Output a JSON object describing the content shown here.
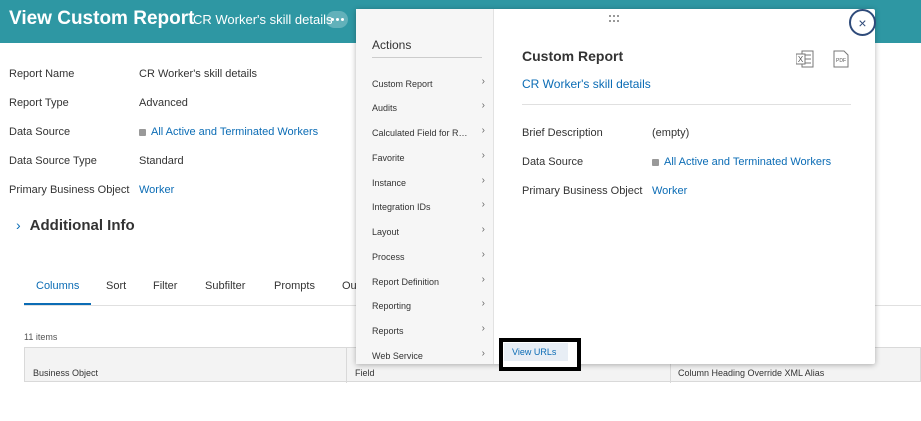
{
  "header": {
    "title": "View Custom Report",
    "subtitle": "CR Worker's skill details",
    "more_icon": "ellipsis-icon"
  },
  "details": [
    {
      "label": "Report Name",
      "value": "CR Worker's skill details",
      "link": false,
      "square": false
    },
    {
      "label": "Report Type",
      "value": "Advanced",
      "link": false,
      "square": false
    },
    {
      "label": "Data Source",
      "value": "All Active and Terminated Workers",
      "link": true,
      "square": true
    },
    {
      "label": "Data Source Type",
      "value": "Standard",
      "link": false,
      "square": false
    },
    {
      "label": "Primary Business Object",
      "value": "Worker",
      "link": true,
      "square": false
    }
  ],
  "additional_info": {
    "chevron": "›",
    "label": "Additional Info"
  },
  "tabs": [
    "Columns",
    "Sort",
    "Filter",
    "Subfilter",
    "Prompts",
    "Ou"
  ],
  "active_tab": "Columns",
  "table": {
    "count": "11 items",
    "headers": [
      "Business Object",
      "Field",
      "Column Heading Override XML Alias"
    ]
  },
  "popup": {
    "actions_title": "Actions",
    "menu": [
      "Custom Report",
      "Audits",
      "Calculated Field for Report",
      "Favorite",
      "Instance",
      "Integration IDs",
      "Layout",
      "Process",
      "Report Definition",
      "Reporting",
      "Reports",
      "Web Service"
    ],
    "menu_arrow": "›",
    "view_urls": "View URLs",
    "title": "Custom Report",
    "name": "CR Worker's skill details",
    "rows": [
      {
        "label": "Brief Description",
        "value": "(empty)",
        "link": false,
        "square": false
      },
      {
        "label": "Data Source",
        "value": "All Active and Terminated Workers",
        "link": true,
        "square": true
      },
      {
        "label": "Primary Business Object",
        "value": "Worker",
        "link": true,
        "square": false
      }
    ],
    "excel_label": "X",
    "pdf_label": "PDF",
    "close_symbol": "×"
  },
  "colors": {
    "header": "#2e97a3",
    "link": "#0b6cb5",
    "close": "#2f4b7a"
  }
}
